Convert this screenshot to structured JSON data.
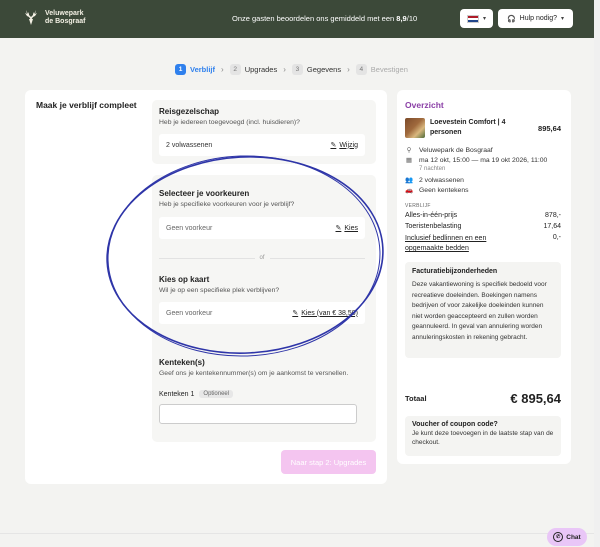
{
  "header": {
    "brand_line1": "Veluwepark",
    "brand_line2": "de Bosgraaf",
    "rating_text": "Onze gasten beoordelen ons gemiddeld met een",
    "rating_value": "8,9",
    "rating_suffix": "/10",
    "help_label": "Hulp nodig?",
    "flag_colors": [
      "#ae1c28",
      "#ffffff",
      "#21468b"
    ]
  },
  "stepper": [
    {
      "num": "1",
      "label": "Verblijf",
      "state": "active"
    },
    {
      "num": "2",
      "label": "Upgrades",
      "state": "todo"
    },
    {
      "num": "3",
      "label": "Gegevens",
      "state": "todo"
    },
    {
      "num": "4",
      "label": "Bevestigen",
      "state": "disabled"
    }
  ],
  "main": {
    "title": "Maak je verblijf compleet",
    "party": {
      "title": "Reisgezelschap",
      "subtitle": "Heb je iedereen toegevoegd (incl. huisdieren)?",
      "value": "2 volwassenen",
      "action": "Wijzig"
    },
    "preferences": {
      "title": "Selecteer je voorkeuren",
      "subtitle": "Heb je specifieke voorkeuren voor je verblijf?",
      "value": "Geen voorkeur",
      "action": "Kies",
      "or_label": "of",
      "map_title": "Kies op kaart",
      "map_subtitle": "Wil je op een specifieke plek verblijven?",
      "map_value": "Geen voorkeur",
      "map_action": "Kies (van € 38,50)"
    },
    "plates": {
      "title": "Kenteken(s)",
      "subtitle": "Geef ons je kentekennummer(s) om je aankomst te versnellen.",
      "field_label": "Kenteken 1",
      "optional_badge": "Optioneel",
      "value": ""
    },
    "next_button": "Naar stap 2: Upgrades"
  },
  "overview": {
    "title": "Overzicht",
    "accommodation": "Loevestein Comfort | 4 personen",
    "accommodation_price": "895,64",
    "park": "Veluwepark de Bosgraaf",
    "dates": "ma 12 okt, 15:00 — ma 19 okt 2026, 11:00",
    "nights": "7 nachten",
    "guests": "2 volwassenen",
    "plates": "Geen kentekens",
    "section_label": "VERBLIJF",
    "lines": [
      {
        "label": "Alles-in-één-prijs",
        "value": "878,-"
      },
      {
        "label": "Toeristenbelasting",
        "value": "17,64"
      },
      {
        "label": "Inclusief bedlinnen en een opgemaakte bedden",
        "value": "0,-"
      }
    ],
    "invoice_title": "Facturatiebijzonderheden",
    "invoice_text": "Deze vakantiewoning is specifiek bedoeld voor recreatieve doeleinden. Boekingen namens bedrijven of voor zakelijke doeleinden kunnen niet worden geaccepteerd en zullen worden geannuleerd. In geval van annulering worden annuleringskosten in rekening gebracht.",
    "total_label": "Totaal",
    "total_value": "€ 895,64",
    "voucher_title": "Voucher of coupon code?",
    "voucher_text": "Je kunt deze toevoegen in de laatste stap van de checkout."
  },
  "chat": {
    "label": "Chat"
  },
  "colors": {
    "header_bg": "#3c4939",
    "accent_blue": "#2f80ed",
    "accent_purple": "#8a3fa6",
    "next_button_bg": "#f4c5f0",
    "annotation_stroke": "#2e35a8"
  }
}
